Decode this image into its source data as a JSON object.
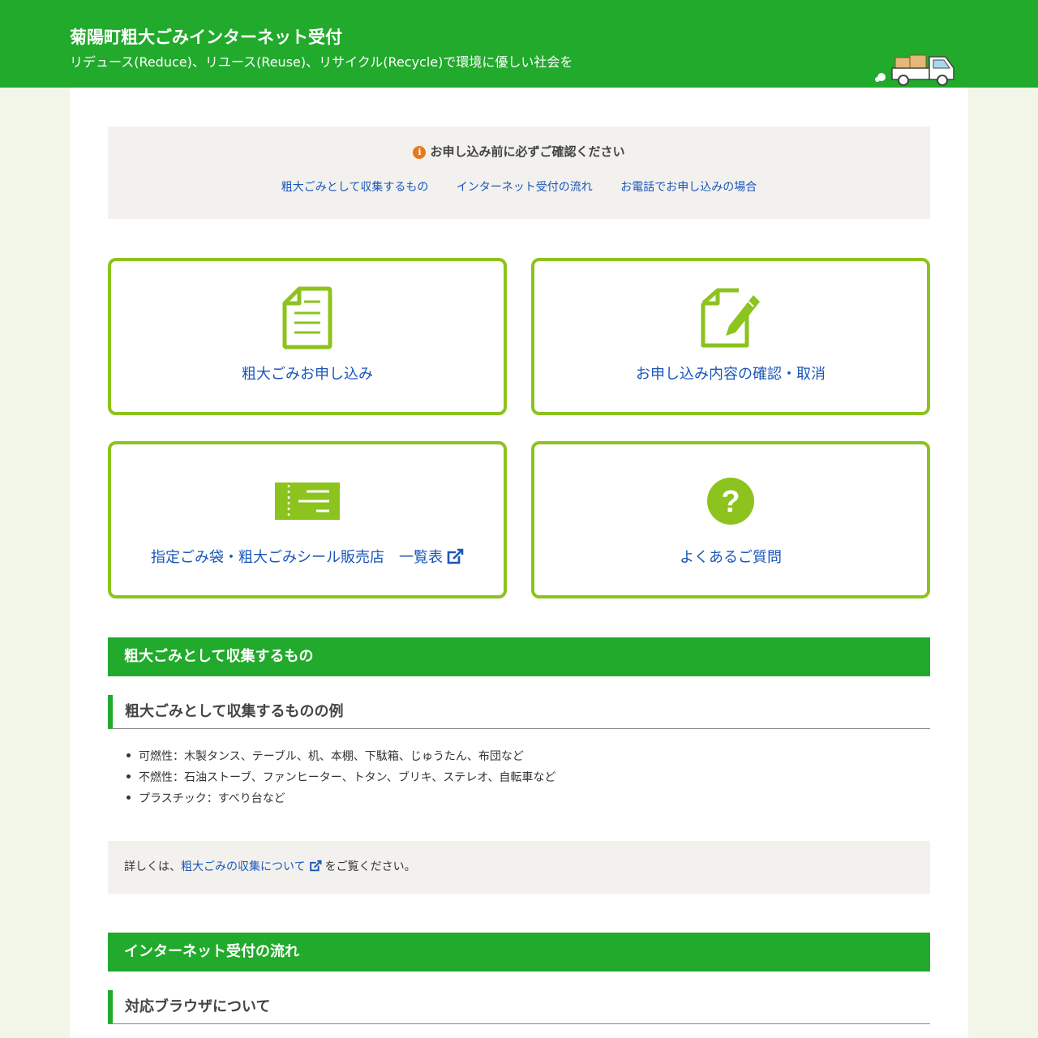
{
  "header": {
    "title": "菊陽町粗大ごみインターネット受付",
    "subtitle": "リデュース(Reduce)、リユース(Reuse)、リサイクル(Recycle)で環境に優しい社会を",
    "truck_icon": "truck-icon"
  },
  "notice": {
    "title": "お申し込み前に必ずご確認ください",
    "info_icon": "i",
    "links": [
      "粗大ごみとして収集するもの",
      "インターネット受付の流れ",
      "お電話でお申し込みの場合"
    ]
  },
  "cards": [
    {
      "label": "粗大ごみお申し込み",
      "icon": "document-icon"
    },
    {
      "label": "お申し込み内容の確認・取消",
      "icon": "edit-icon"
    },
    {
      "label": "指定ごみ袋・粗大ごみシール販売店　一覧表",
      "icon": "ticket-icon",
      "external": true
    },
    {
      "label": "よくあるご質問",
      "icon": "question-icon"
    }
  ],
  "section_collect": {
    "heading": "粗大ごみとして収集するもの",
    "subheading": "粗大ごみとして収集するものの例",
    "items": [
      "可燃性：木製タンス、テーブル、机、本棚、下駄箱、じゅうたん、布団など",
      "不燃性：石油ストーブ、ファンヒーター、トタン、ブリキ、ステレオ、自転車など",
      "プラスチック：すべり台など"
    ],
    "detail_prefix": "詳しくは、",
    "detail_link": "粗大ごみの収集について",
    "detail_suffix": "をご覧ください。"
  },
  "section_flow": {
    "heading": "インターネット受付の流れ",
    "subheading": "対応ブラウザについて"
  },
  "colors": {
    "brand_green": "#21aa2c",
    "card_border": "#8cc31e",
    "link_blue": "#1a56b8",
    "info_orange": "#e9781a"
  }
}
